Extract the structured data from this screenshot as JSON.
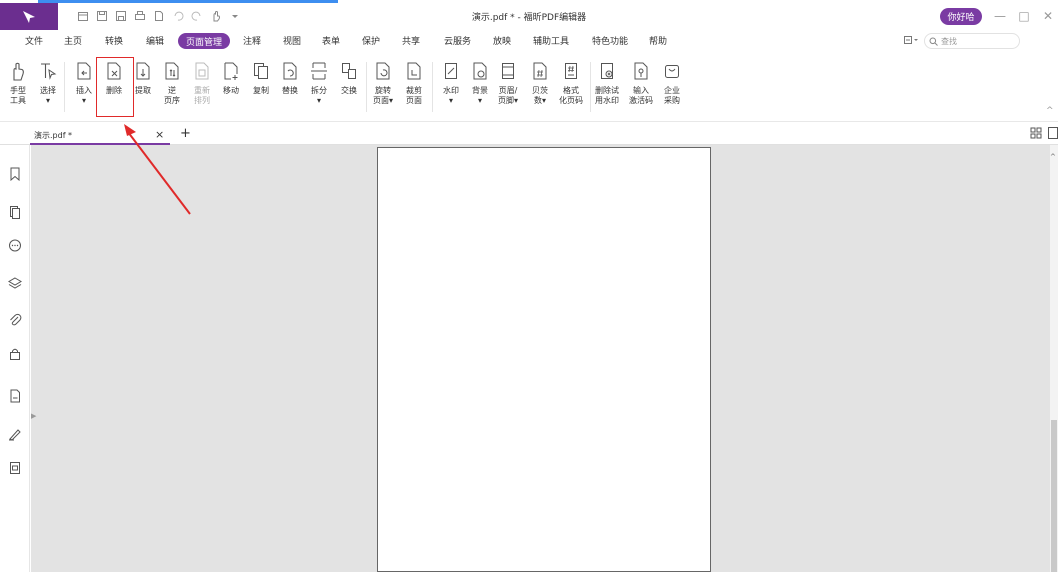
{
  "titlebar": {
    "document_title": "演示.pdf * - 福昕PDF编辑器",
    "login_label": "你好哈",
    "quick_access_icons": [
      "open-icon",
      "save-icon",
      "save-as-icon",
      "print-icon",
      "new-icon",
      "undo-icon",
      "redo-icon",
      "hand-cursor-icon",
      "dropdown-icon"
    ]
  },
  "menu": {
    "items": [
      "文件",
      "主页",
      "转换",
      "编辑",
      "页面管理",
      "注释",
      "视图",
      "表单",
      "保护",
      "共享",
      "云服务",
      "放映",
      "辅助工具",
      "特色功能",
      "帮助"
    ],
    "active": "页面管理",
    "search_placeholder": "查找"
  },
  "ribbon": {
    "tools": [
      {
        "label1": "手型",
        "label2": "工具"
      },
      {
        "label1": "选择",
        "label2": "▾"
      },
      {
        "label1": "插入",
        "label2": "▾"
      },
      {
        "label1": "删除",
        "label2": ""
      },
      {
        "label1": "提取",
        "label2": ""
      },
      {
        "label1": "逆",
        "label2": "页序"
      },
      {
        "label1": "重新",
        "label2": "排列"
      },
      {
        "label1": "移动",
        "label2": ""
      },
      {
        "label1": "复制",
        "label2": ""
      },
      {
        "label1": "替换",
        "label2": ""
      },
      {
        "label1": "拆分",
        "label2": "▾"
      },
      {
        "label1": "交换",
        "label2": ""
      },
      {
        "label1": "旋转",
        "label2": "页面▾"
      },
      {
        "label1": "裁剪",
        "label2": "页面"
      },
      {
        "label1": "水印",
        "label2": "▾"
      },
      {
        "label1": "背景",
        "label2": "▾"
      },
      {
        "label1": "页眉/",
        "label2": "页脚▾"
      },
      {
        "label1": "贝茨",
        "label2": "数▾"
      },
      {
        "label1": "格式",
        "label2": "化页码"
      },
      {
        "label1": "删除试",
        "label2": "用水印"
      },
      {
        "label1": "输入",
        "label2": "激活码"
      },
      {
        "label1": "企业",
        "label2": "采购"
      }
    ]
  },
  "tabs": {
    "doc_tab_label": "演示.pdf *",
    "close_symbol": "×",
    "add_symbol": "+"
  },
  "sidebar": {
    "icons": [
      "bookmark-icon",
      "pages-icon",
      "comment-icon",
      "layers-icon",
      "attachment-icon",
      "security-icon",
      "document-icon",
      "signature-icon",
      "form-icon"
    ]
  },
  "colors": {
    "brand_purple": "#7a3ba3",
    "logo_purple": "#6b2e8f",
    "highlight_red": "#e02a2a",
    "workspace_gray": "#e3e3e3"
  }
}
